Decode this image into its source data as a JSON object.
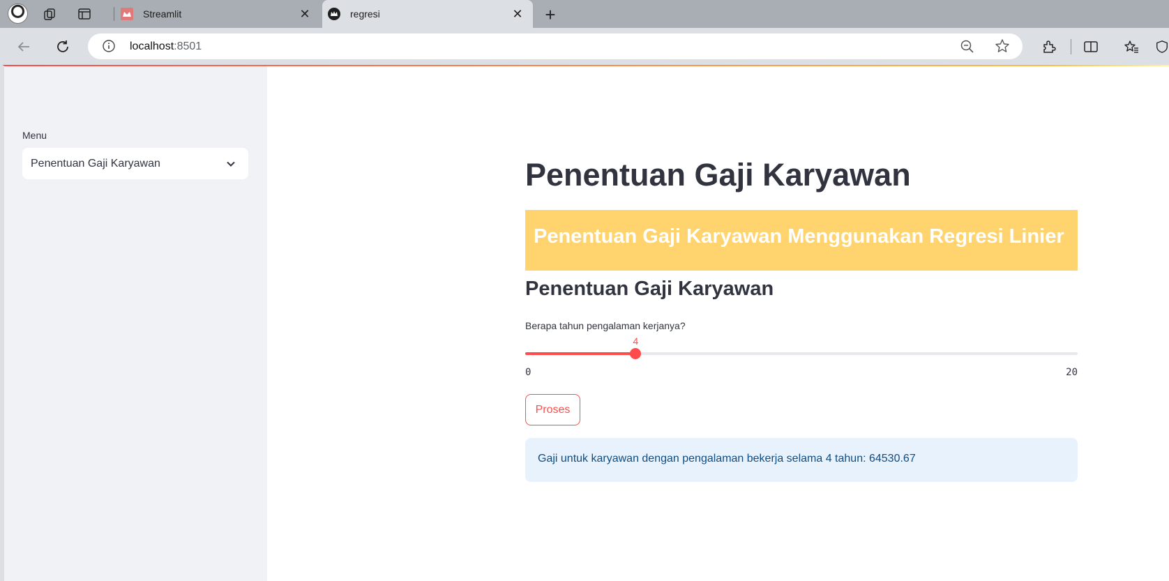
{
  "browser": {
    "tabs": [
      {
        "title": "Streamlit",
        "active": false
      },
      {
        "title": "regresi",
        "active": true
      }
    ],
    "url_host": "localhost",
    "url_port": ":8501",
    "colors": {
      "tabbar": "#a9aeb5",
      "toolbar": "#dcdfe3"
    }
  },
  "sidebar": {
    "menu_label": "Menu",
    "menu_selected": "Penentuan Gaji Karyawan"
  },
  "main": {
    "title": "Penentuan Gaji Karyawan",
    "banner_text": "Penentuan Gaji Karyawan Menggunakan Regresi Linier",
    "subheader": "Penentuan Gaji Karyawan",
    "slider": {
      "label": "Berapa tahun pengalaman kerjanya?",
      "value": 4,
      "min": 0,
      "max": 20
    },
    "button_label": "Proses",
    "result_text": "Gaji untuk karyawan dengan pengalaman bekerja selama 4 tahun: 64530.67"
  },
  "colors": {
    "primary": "#ff4b4b",
    "banner": "#ffd36d",
    "info_bg": "#e8f2fc",
    "info_text": "#0e4c82",
    "sidebar_bg": "#f0f2f6"
  }
}
